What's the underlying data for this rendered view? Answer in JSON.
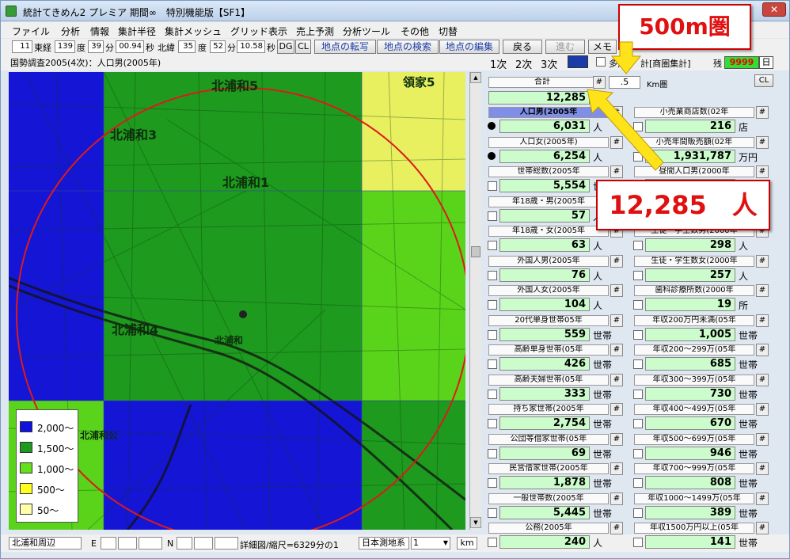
{
  "window": {
    "title": "統計てきめん2 プレミア 期間∞　特別機能版【SF1】"
  },
  "menu": [
    "ファイル",
    "分析",
    "情報",
    "集計半径",
    "集計メッシュ",
    "グリッド表示",
    "売上予測",
    "分析ツール",
    "その他",
    "切替"
  ],
  "toolbar": {
    "zoom": "11",
    "lon_label": "東経",
    "lon_deg": "139",
    "deg": "度",
    "lon_min": "39",
    "min": "分",
    "lon_sec": "00.94",
    "sec": "秒",
    "lat_label": "北緯",
    "lat_deg": "35",
    "lat_min": "52",
    "lat_sec": "10.58",
    "btn_dg": "DG",
    "btn_cl": "CL",
    "btn_copy": "地点の転写",
    "btn_search": "地点の検索",
    "btn_edit": "地点の編集",
    "btn_back": "戻る",
    "btn_forward": "進む",
    "btn_memo": "メモ"
  },
  "infobar": {
    "dataset": "国勢調査2005(4次)：人口男(2005年)",
    "tab1": "1次",
    "tab2": "2次",
    "tab3": "3次",
    "multi": "多角",
    "total_label": "計[商圏集計]",
    "remain_label": "残",
    "remain_value": "9999",
    "day_label": "日"
  },
  "map": {
    "legend": [
      {
        "label": "2,000〜",
        "color": "#1111dd"
      },
      {
        "label": "1,500〜",
        "color": "#1e9a1e"
      },
      {
        "label": "1,000〜",
        "color": "#66e01a"
      },
      {
        "label": "500〜",
        "color": "#ffff22"
      },
      {
        "label": "50〜",
        "color": "#ffffaa"
      }
    ],
    "place_labels": [
      "北浦和3",
      "北浦和4",
      "北浦和5",
      "北浦和1",
      "領家5",
      "北浦和公",
      "北浦和"
    ],
    "colors": {
      "blue": "#1515d6",
      "green": "#1e9a1e",
      "lime": "#5ad41a",
      "yellow": "#e8f060",
      "circle": "#dd1a1a"
    }
  },
  "status": {
    "area": "北浦和周辺",
    "e_label": "E",
    "n_label": "N",
    "scale": "詳細図/縮尺=6329分の1",
    "datum": "日本測地系",
    "radius_select": "1",
    "km": "km"
  },
  "panel": {
    "header": {
      "total_label": "合計",
      "hash": "#",
      "radius_value": ".5",
      "radius_unit": "Km圏",
      "cl": "CL",
      "total_value": "12,285",
      "total_unit": "人"
    },
    "left": [
      {
        "label": "人口男(2005年",
        "value": "6,031",
        "unit": "人",
        "selected": true
      },
      {
        "label": "人口女(2005年)",
        "value": "6,254",
        "unit": "人"
      },
      {
        "label": "世帯総数(2005年",
        "value": "5,554",
        "unit": "世帯"
      },
      {
        "label": "年18歳・男(2005年",
        "value": "57",
        "unit": "人"
      },
      {
        "label": "年18歳・女(2005年",
        "value": "63",
        "unit": "人"
      },
      {
        "label": "外国人男(2005年",
        "value": "76",
        "unit": "人"
      },
      {
        "label": "外国人女(2005年",
        "value": "104",
        "unit": "人"
      },
      {
        "label": "20代単身世帯05年",
        "value": "559",
        "unit": "世帯"
      },
      {
        "label": "高齢単身世帯(05年",
        "value": "426",
        "unit": "世帯"
      },
      {
        "label": "高齢夫婦世帯(05年",
        "value": "333",
        "unit": "世帯"
      },
      {
        "label": "持ち家世帯(2005年",
        "value": "2,754",
        "unit": "世帯"
      },
      {
        "label": "公団等借家世帯(05年",
        "value": "69",
        "unit": "世帯"
      },
      {
        "label": "民営借家世帯(2005年",
        "value": "1,878",
        "unit": "世帯"
      },
      {
        "label": "一般世帯数(2005年",
        "value": "5,445",
        "unit": "世帯"
      },
      {
        "label": "公務(2005年",
        "value": "240",
        "unit": "人"
      }
    ],
    "right": [
      {
        "label": "小売業商店数(02年",
        "value": "216",
        "unit": "店"
      },
      {
        "label": "小売年間販売額(02年",
        "value": "1,931,787",
        "unit": "万円"
      },
      {
        "label": "昼間人口男(2000年",
        "value": "",
        "unit": ""
      },
      {
        "label": "",
        "value": "",
        "unit": ""
      },
      {
        "label": "生徒・学生数男(2000年",
        "value": "298",
        "unit": "人"
      },
      {
        "label": "生徒・学生数女(2000年",
        "value": "257",
        "unit": "人"
      },
      {
        "label": "歯科診療所数(2000年",
        "value": "19",
        "unit": "所"
      },
      {
        "label": "年収200万円未満(05年",
        "value": "1,005",
        "unit": "世帯"
      },
      {
        "label": "年収200〜299万(05年",
        "value": "685",
        "unit": "世帯"
      },
      {
        "label": "年収300〜399万(05年",
        "value": "730",
        "unit": "世帯"
      },
      {
        "label": "年収400〜499万(05年",
        "value": "670",
        "unit": "世帯"
      },
      {
        "label": "年収500〜699万(05年",
        "value": "946",
        "unit": "世帯"
      },
      {
        "label": "年収700〜999万(05年",
        "value": "808",
        "unit": "世帯"
      },
      {
        "label": "年収1000〜1499万(05年",
        "value": "389",
        "unit": "世帯"
      },
      {
        "label": "年収1500万円以上(05年",
        "value": "141",
        "unit": "世帯"
      }
    ]
  },
  "callouts": {
    "radius": "500m圏",
    "total": "12,285　人"
  }
}
